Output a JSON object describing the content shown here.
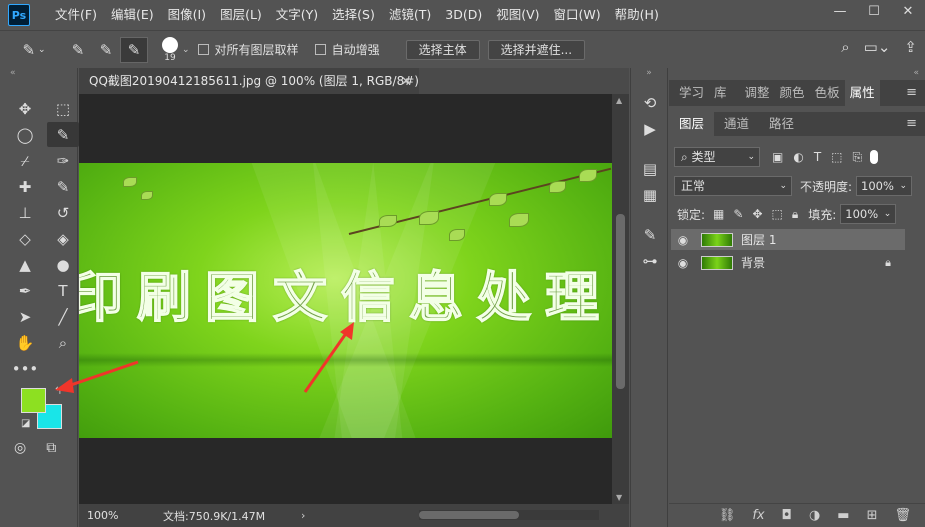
{
  "app": {
    "logo": "Ps"
  },
  "menu": [
    "文件(F)",
    "编辑(E)",
    "图像(I)",
    "图层(L)",
    "文字(Y)",
    "选择(S)",
    "滤镜(T)",
    "3D(D)",
    "视图(V)",
    "窗口(W)",
    "帮助(H)"
  ],
  "options_bar": {
    "brush_size": "19",
    "sample_all_layers": "对所有图层取样",
    "auto_enhance": "自动增强",
    "select_subject": "选择主体",
    "select_and_mask": "选择并遮住..."
  },
  "document": {
    "tab_title": "QQ截图20190412185611.jpg @ 100% (图层 1, RGB/8#) *",
    "canvas_text": "印刷图文信息处理专",
    "zoom": "100%",
    "doc_info": "文档:750.9K/1.47M"
  },
  "panels": {
    "top_tabs": [
      "学习",
      "库",
      "调整",
      "颜色",
      "色板",
      "属性"
    ],
    "active_top_tab": "属性",
    "layer_tabs": [
      "图层",
      "通道",
      "路径"
    ],
    "kind_filter": "类型",
    "blend_mode": "正常",
    "opacity_label": "不透明度:",
    "opacity_value": "100%",
    "lock_label": "锁定:",
    "fill_label": "填充:",
    "fill_value": "100%",
    "layers": [
      {
        "name": "图层 1",
        "selected": true,
        "locked": false
      },
      {
        "name": "背景",
        "selected": false,
        "locked": true
      }
    ]
  },
  "colors": {
    "foreground": "#8de021",
    "background": "#19e5e8",
    "annotation_arrow": "#f0352a"
  }
}
